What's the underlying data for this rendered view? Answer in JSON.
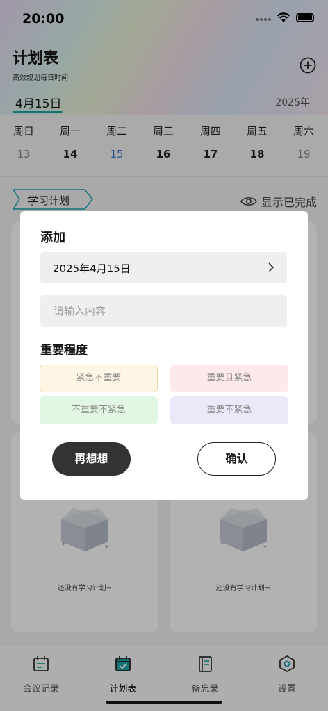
{
  "status_bar": {
    "time": "20:00"
  },
  "header": {
    "title": "计划表",
    "subtitle": "高效规划每日时间",
    "current_date": "4月15日",
    "year": "2025年"
  },
  "week": {
    "days": [
      {
        "name": "周日",
        "num": "13"
      },
      {
        "name": "周一",
        "num": "14"
      },
      {
        "name": "周二",
        "num": "15"
      },
      {
        "name": "周三",
        "num": "16"
      },
      {
        "name": "周四",
        "num": "17"
      },
      {
        "name": "周五",
        "num": "18"
      },
      {
        "name": "周六",
        "num": "19"
      }
    ],
    "selected_index": 2
  },
  "section": {
    "tag": "学习计划",
    "show_done": "显示已完成"
  },
  "cards": {
    "empty_text": "还没有学习计划~"
  },
  "modal": {
    "title": "添加",
    "date": "2025年4月15日",
    "content_placeholder": "请输入内容",
    "priority_title": "重要程度",
    "priorities": [
      {
        "label": "紧急不重要",
        "color": "#fff6e6"
      },
      {
        "label": "重要且紧急",
        "color": "#fde8ea"
      },
      {
        "label": "不重要不紧急",
        "color": "#e1f6e3"
      },
      {
        "label": "重要不紧急",
        "color": "#ebe8fa"
      }
    ],
    "cancel_label": "再想想",
    "confirm_label": "确认"
  },
  "tabbar": {
    "items": [
      {
        "label": "会议记录",
        "icon": "meeting-calendar-icon"
      },
      {
        "label": "计划表",
        "icon": "plan-calendar-icon",
        "active": true
      },
      {
        "label": "备忘录",
        "icon": "notebook-icon"
      },
      {
        "label": "设置",
        "icon": "settings-hexagon-icon"
      }
    ]
  },
  "colors": {
    "accent": "#1aa5a8",
    "selected_day": "#3a78c9"
  }
}
